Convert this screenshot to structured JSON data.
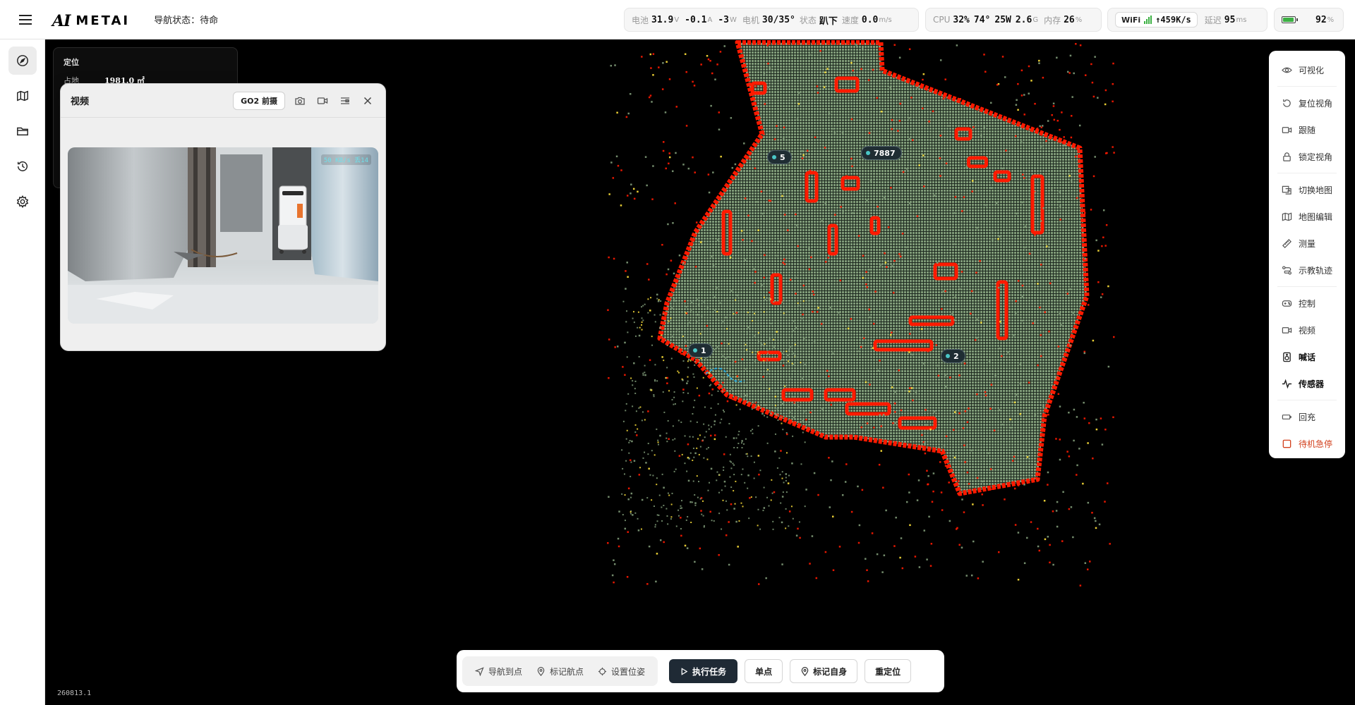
{
  "header": {
    "logo_mark": "AI",
    "logo_name": "METAI",
    "nav_status": "导航状态：待命"
  },
  "status": {
    "battery_label": "电池",
    "voltage": "31.9",
    "voltage_unit": "V",
    "current": "-0.1",
    "current_unit": "A",
    "power": "-3",
    "power_unit": "W",
    "motor_label": "电机",
    "motor_temp": "30/35°",
    "state_label": "状态",
    "state_value": "趴下",
    "speed_label": "速度",
    "speed_value": "0.0",
    "speed_unit": "m/s",
    "cpu_label": "CPU",
    "cpu_usage": "32%",
    "cpu_temp": "74°",
    "cpu_power": "25W",
    "cpu_mem": "2.6",
    "cpu_mem_unit": "G",
    "mem_label": "内存",
    "mem_usage": "26",
    "mem_unit": "%",
    "wifi_label": "WiFi",
    "wifi_rate": "↑459K/s",
    "latency_label": "延迟",
    "latency_value": "95",
    "latency_unit": "ms",
    "battery_pct": "92",
    "battery_unit": "%",
    "battery_level": 0.92,
    "battery_color": "#3cb043"
  },
  "left_nav": {
    "items": [
      {
        "icon": "compass-icon",
        "active": true
      },
      {
        "icon": "map-icon",
        "active": false
      },
      {
        "icon": "folder-icon",
        "active": false
      },
      {
        "icon": "history-icon",
        "active": false
      },
      {
        "icon": "gear-icon",
        "active": false
      }
    ]
  },
  "locate": {
    "title": "定位",
    "area_label": "占地",
    "area_value": "1981.0 ㎡"
  },
  "video": {
    "title": "视频",
    "camera": "GO2 前摄",
    "overlay": "50 KB/s 丢14",
    "icons": [
      "camera-icon",
      "record-icon",
      "layout-icon",
      "close-icon"
    ]
  },
  "map": {
    "markers": [
      {
        "label": "5"
      },
      {
        "label": "7887"
      },
      {
        "label": "1"
      },
      {
        "label": "2"
      }
    ],
    "colors": {
      "floor": "#7f9a78",
      "wall": "#ff1a00",
      "highlight": "#ffe23a",
      "path": "#2aa6d8"
    }
  },
  "tools": {
    "items": [
      {
        "label": "可视化",
        "icon": "eye-icon"
      },
      {
        "label": "复位视角",
        "icon": "reset-view-icon"
      },
      {
        "label": "跟随",
        "icon": "follow-icon"
      },
      {
        "label": "锁定视角",
        "icon": "lock-icon"
      },
      {
        "label": "切换地图",
        "icon": "switch-map-icon"
      },
      {
        "label": "地图编辑",
        "icon": "map-edit-icon"
      },
      {
        "label": "测量",
        "icon": "ruler-icon"
      },
      {
        "label": "示教轨迹",
        "icon": "route-icon"
      },
      {
        "label": "控制",
        "icon": "gamepad-icon"
      },
      {
        "label": "视频",
        "icon": "video-icon"
      },
      {
        "label": "喊话",
        "icon": "speaker-icon"
      },
      {
        "label": "传感器",
        "icon": "pulse-icon"
      },
      {
        "label": "回充",
        "icon": "charge-icon"
      },
      {
        "label": "待机急停",
        "icon": "stop-icon"
      }
    ]
  },
  "actions": {
    "nav_to_point": "导航到点",
    "mark_waypoint": "标记航点",
    "set_pose": "设置位姿",
    "execute_task": "执行任务",
    "single_point": "单点",
    "mark_self": "标记自身",
    "relocate": "重定位"
  },
  "version": "260813.1"
}
